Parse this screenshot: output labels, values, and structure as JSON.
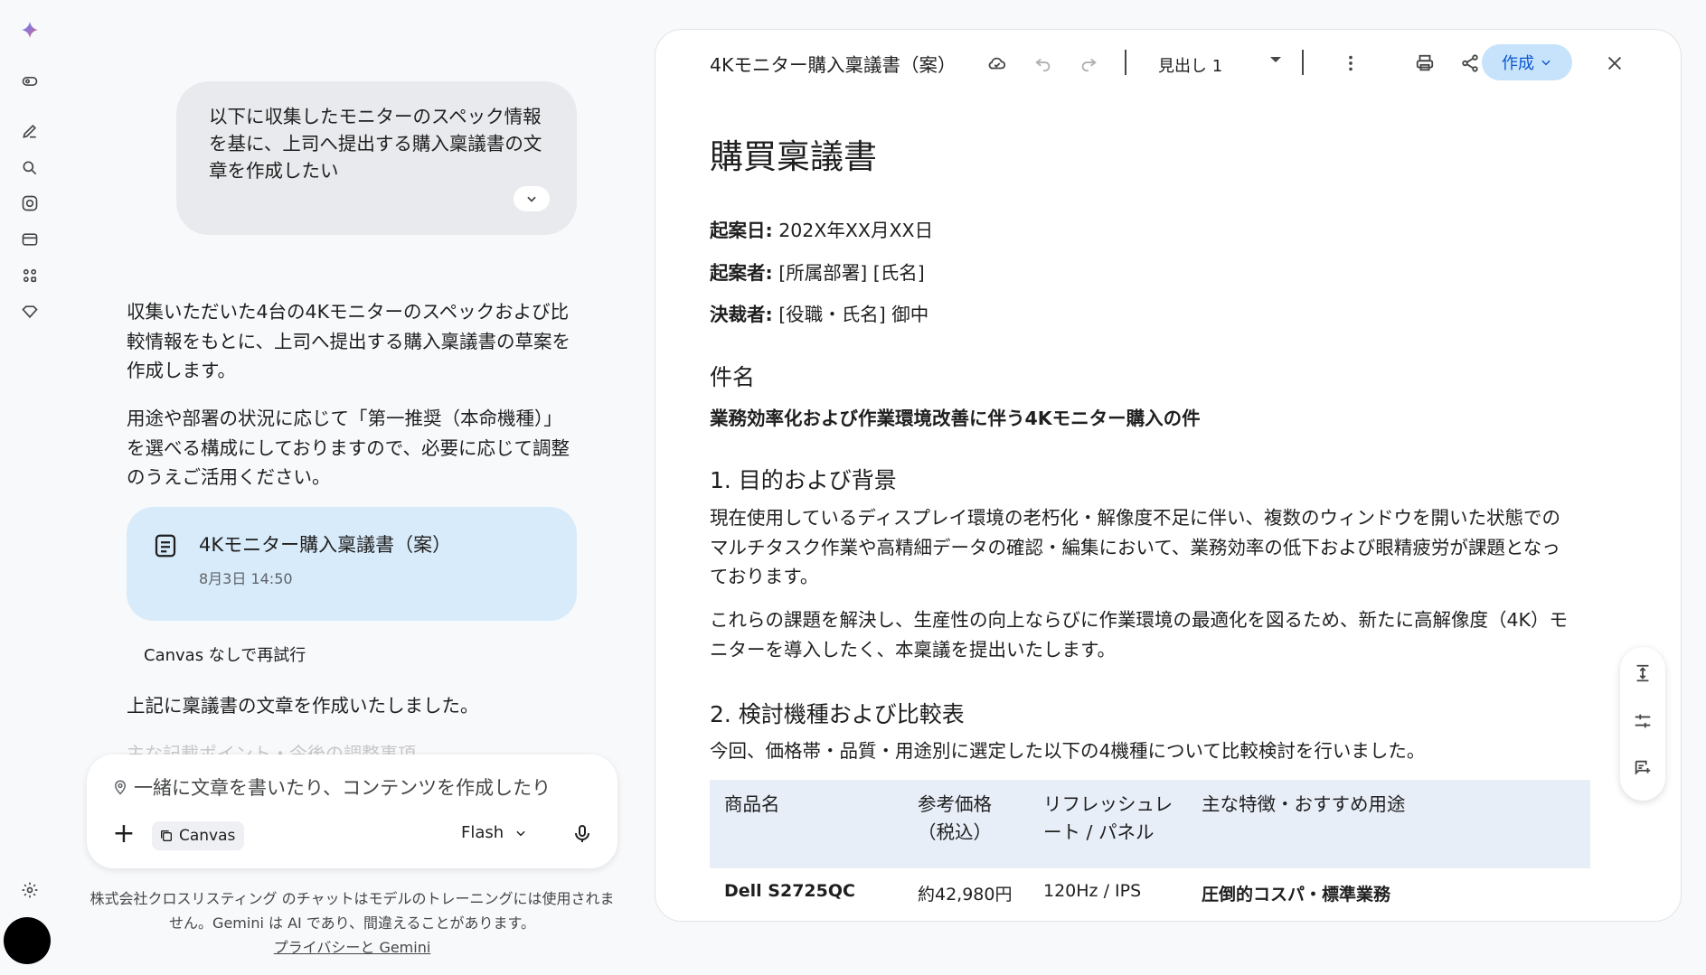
{
  "rail": {
    "icons": [
      "gemini-spark-icon",
      "sidebar-toggle-icon",
      "new-chat-icon",
      "search-icon",
      "explore-icon",
      "saved-icon",
      "apps-icon",
      "gems-icon",
      "settings-icon"
    ]
  },
  "chat": {
    "user_message": "以下に収集したモニターのスペック情報を基に、上司へ提出する購入稟議書の文章を作成したい",
    "response_p1": "収集いただいた4台の4Kモニターのスペックおよび比較情報をもとに、上司へ提出する購入稟議書の草案を作成します。",
    "response_p2": "用途や部署の状況に応じて「第一推奨（本命機種）」を選べる構成にしておりますので、必要に応じて調整のうえご活用ください。",
    "doc_card_title": "4Kモニター購入稟議書（案）",
    "doc_card_date": "8月3日 14:50",
    "retry_label": "Canvas なしで再試行",
    "response_p3": "上記に稟議書の文章を作成いたしました。",
    "fade_text": "主な記載ポイント・今後の調整事項"
  },
  "input": {
    "placeholder": "一緒に文章を書いたり、コンテンツを作成したり",
    "canvas_chip": "Canvas",
    "model": "Flash"
  },
  "disclaimer": {
    "line1": "株式会社クロスリスティング のチャットはモデルのトレーニングには使用されません。Gemini は AI であり、間違えることがあります。",
    "link": "プライバシーと Gemini"
  },
  "canvas": {
    "title": "4Kモニター購入稟議書（案）",
    "heading_style": "見出し 1",
    "create_label": "作成"
  },
  "doc": {
    "h1": "購買稟議書",
    "date_label": "起案日:",
    "date_value": " 202X年XX月XX日",
    "drafter_label": "起案者:",
    "drafter_value": " [所属部署] [氏名]",
    "approver_label": "決裁者:",
    "approver_value": " [役職・氏名] 御中",
    "subject_heading": "件名",
    "subject": "業務効率化および作業環境改善に伴う4Kモニター購入の件",
    "sec1_heading": "1. 目的および背景",
    "sec1_p1": "現在使用しているディスプレイ環境の老朽化・解像度不足に伴い、複数のウィンドウを開いた状態でのマルチタスク作業や高精細データの確認・編集において、業務効率の低下および眼精疲労が課題となっております。",
    "sec1_p2": "これらの課題を解決し、生産性の向上ならびに作業環境の最適化を図るため、新たに高解像度（4K）モニターを導入したく、本稟議を提出いたします。",
    "sec2_heading": "2. 検討機種および比較表",
    "sec2_p1": "今回、価格帯・品質・用途別に選定した以下の4機種について比較検討を行いました。",
    "table": {
      "headers": [
        "商品名",
        "参考価格（税込）",
        "リフレッシュレート / パネル",
        "主な特徴・おすすめ用途"
      ],
      "rows": [
        [
          "Dell S2725QC",
          "約42,980円",
          "120Hz / IPS",
          "圧倒的コスパ・標準業務"
        ]
      ]
    }
  }
}
